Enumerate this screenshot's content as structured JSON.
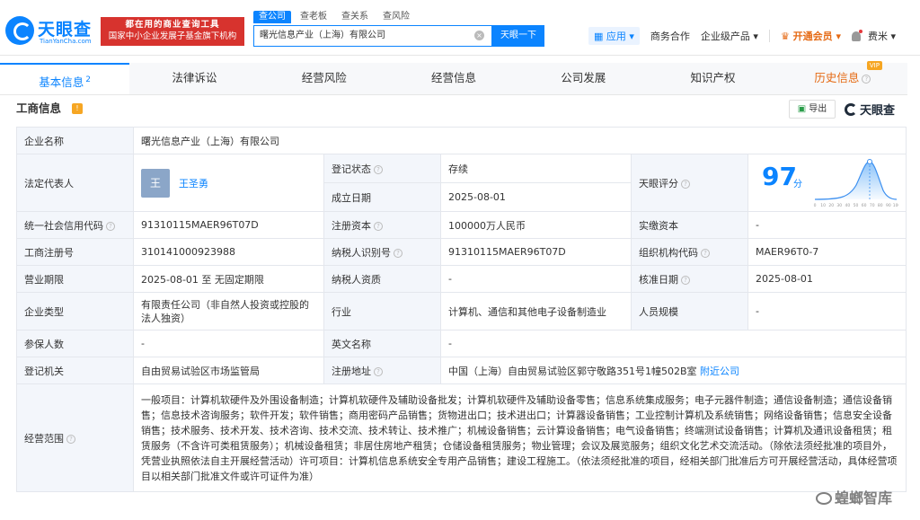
{
  "header": {
    "logo_cn": "天眼查",
    "logo_en": "TianYanCha.com",
    "slogan_line1": "都在用的商业查询工具",
    "slogan_line2": "国家中小企业发展子基金旗下机构",
    "search_tabs": [
      "查公司",
      "查老板",
      "查关系",
      "查风险"
    ],
    "search_value": "曙光信息产业（上海）有限公司",
    "search_button": "天眼一下",
    "nav": {
      "app": "应用",
      "business": "商务合作",
      "enterprise": "企业级产品",
      "vip": "开通会员",
      "user": "费米"
    }
  },
  "tabs": [
    {
      "label": "基本信息",
      "count": "2"
    },
    {
      "label": "法律诉讼"
    },
    {
      "label": "经营风险"
    },
    {
      "label": "经营信息"
    },
    {
      "label": "公司发展"
    },
    {
      "label": "知识产权"
    },
    {
      "label": "历史信息",
      "badge": "VIP"
    }
  ],
  "section": {
    "title": "工商信息",
    "export_label": "导出",
    "brand": "天眼查"
  },
  "info": {
    "company_name_label": "企业名称",
    "company_name": "曙光信息产业（上海）有限公司",
    "legal_rep_label": "法定代表人",
    "legal_rep_avatar": "王",
    "legal_rep": "王圣勇",
    "reg_status_label": "登记状态",
    "reg_status": "存续",
    "found_date_label": "成立日期",
    "found_date": "2025-08-01",
    "score_label": "天眼评分",
    "score": "97",
    "score_unit": "分",
    "score_axis": [
      "0",
      "10",
      "20",
      "30",
      "40",
      "50",
      "60",
      "70",
      "80",
      "90",
      "100"
    ],
    "credit_code_label": "统一社会信用代码",
    "credit_code": "91310115MAER96T07D",
    "reg_capital_label": "注册资本",
    "reg_capital": "100000万人民币",
    "paid_capital_label": "实缴资本",
    "paid_capital": "-",
    "reg_no_label": "工商注册号",
    "reg_no": "310141000923988",
    "tax_id_label": "纳税人识别号",
    "tax_id": "91310115MAER96T07D",
    "org_code_label": "组织机构代码",
    "org_code": "MAER96T0-7",
    "term_label": "营业期限",
    "term": "2025-08-01 至 无固定期限",
    "taxpayer_qual_label": "纳税人资质",
    "taxpayer_qual": "-",
    "approve_date_label": "核准日期",
    "approve_date": "2025-08-01",
    "company_type_label": "企业类型",
    "company_type": "有限责任公司（非自然人投资或控股的法人独资）",
    "industry_label": "行业",
    "industry": "计算机、通信和其他电子设备制造业",
    "staff_size_label": "人员规模",
    "staff_size": "-",
    "insured_label": "参保人数",
    "insured": "-",
    "en_name_label": "英文名称",
    "en_name": "-",
    "authority_label": "登记机关",
    "authority": "自由贸易试验区市场监管局",
    "address_label": "注册地址",
    "address": "中国（上海）自由贸易试验区郭守敬路351号1幢502B室",
    "nearby_label": "附近公司",
    "scope_label": "经营范围",
    "scope": "一般项目：计算机软硬件及外围设备制造；计算机软硬件及辅助设备批发；计算机软硬件及辅助设备零售；信息系统集成服务；电子元器件制造；通信设备制造；通信设备销售；信息技术咨询服务；软件开发；软件销售；商用密码产品销售；货物进出口；技术进出口；计算器设备销售；工业控制计算机及系统销售；网络设备销售；信息安全设备销售；技术服务、技术开发、技术咨询、技术交流、技术转让、技术推广；机械设备销售；云计算设备销售；电气设备销售；终端测试设备销售；计算机及通讯设备租赁；租赁服务（不含许可类租赁服务）；机械设备租赁；非居住房地产租赁；仓储设备租赁服务；物业管理；会议及展览服务；组织文化艺术交流活动。（除依法须经批准的项目外，凭营业执照依法自主开展经营活动）许可项目：计算机信息系统安全专用产品销售；建设工程施工。（依法须经批准的项目，经相关部门批准后方可开展经营活动，具体经营项目以相关部门批准文件或许可证件为准）"
  },
  "watermark": "蝗螂智库",
  "colors": {
    "brand_blue": "#0b84ff",
    "slogan_red": "#d7332e",
    "status_green": "#2a9d4a",
    "vip_orange": "#e56a14"
  }
}
